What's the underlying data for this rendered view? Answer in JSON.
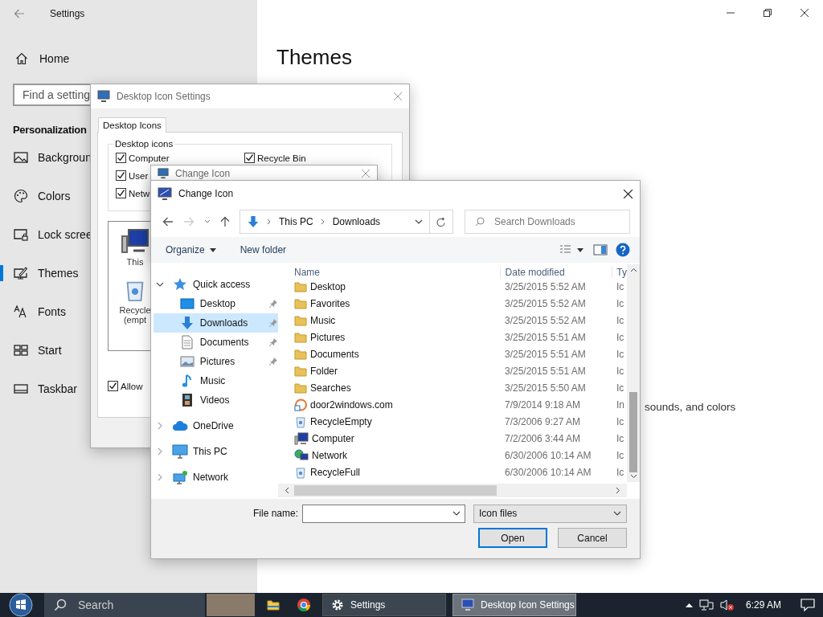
{
  "settings": {
    "title": "Settings",
    "home": "Home",
    "search_placeholder": "Find a setting",
    "section": "Personalization",
    "items": [
      {
        "label": "Backgroun",
        "selected": false
      },
      {
        "label": "Colors",
        "selected": false
      },
      {
        "label": "Lock scree",
        "selected": false
      },
      {
        "label": "Themes",
        "selected": true
      },
      {
        "label": "Fonts",
        "selected": false
      },
      {
        "label": "Start",
        "selected": false
      },
      {
        "label": "Taskbar",
        "selected": false
      }
    ],
    "heading": "Themes",
    "body_text": "sounds, and colors"
  },
  "desktop_icon_settings": {
    "title": "Desktop Icon Settings",
    "tab": "Desktop Icons",
    "group": "Desktop icons",
    "checkboxes": [
      {
        "label": "Computer",
        "checked": true
      },
      {
        "label": "Recycle Bin",
        "checked": true
      },
      {
        "label": "User",
        "checked": true
      },
      {
        "label": "Netw",
        "checked": true
      }
    ],
    "icons": [
      {
        "lines": [
          "This"
        ]
      },
      {
        "lines": [
          "Recycle",
          "(empt"
        ]
      }
    ],
    "allow": {
      "label": "Allow",
      "checked": true
    }
  },
  "change_icon_back": {
    "title": "Change Icon"
  },
  "dialog": {
    "title": "Change Icon",
    "breadcrumb": [
      "This PC",
      "Downloads"
    ],
    "search_placeholder": "Search Downloads",
    "organize": "Organize",
    "new_folder": "New folder",
    "nav_tree": [
      {
        "label": "Quick access",
        "expanded": true,
        "selected": false,
        "children": [
          {
            "label": "Desktop",
            "pinned": true,
            "selected": false
          },
          {
            "label": "Downloads",
            "pinned": true,
            "selected": true
          },
          {
            "label": "Documents",
            "pinned": true,
            "selected": false
          },
          {
            "label": "Pictures",
            "pinned": true,
            "selected": false
          },
          {
            "label": "Music",
            "pinned": false,
            "selected": false
          },
          {
            "label": "Videos",
            "pinned": false,
            "selected": false
          }
        ]
      },
      {
        "label": "OneDrive",
        "expanded": false,
        "selected": false
      },
      {
        "label": "This PC",
        "expanded": false,
        "selected": false
      },
      {
        "label": "Network",
        "expanded": false,
        "selected": false
      }
    ],
    "columns": [
      "Name",
      "Date modified",
      "Ty"
    ],
    "rows": [
      {
        "name": "Desktop",
        "date": "3/25/2015 5:52 AM",
        "type": "Ic",
        "kind": "folder"
      },
      {
        "name": "Favorites",
        "date": "3/25/2015 5:52 AM",
        "type": "Ic",
        "kind": "folder"
      },
      {
        "name": "Music",
        "date": "3/25/2015 5:52 AM",
        "type": "Ic",
        "kind": "folder"
      },
      {
        "name": "Pictures",
        "date": "3/25/2015 5:51 AM",
        "type": "Ic",
        "kind": "folder"
      },
      {
        "name": "Documents",
        "date": "3/25/2015 5:51 AM",
        "type": "Ic",
        "kind": "folder"
      },
      {
        "name": "Folder",
        "date": "3/25/2015 5:51 AM",
        "type": "Ic",
        "kind": "folder"
      },
      {
        "name": "Searches",
        "date": "3/25/2015 5:50 AM",
        "type": "Ic",
        "kind": "folder"
      },
      {
        "name": "door2windows.com",
        "date": "7/9/2014 9:18 AM",
        "type": "In",
        "kind": "link"
      },
      {
        "name": "RecycleEmpty",
        "date": "7/3/2006 9:27 AM",
        "type": "Ic",
        "kind": "bin"
      },
      {
        "name": "Computer",
        "date": "7/2/2006 3:44 AM",
        "type": "Ic",
        "kind": "computer"
      },
      {
        "name": "Network",
        "date": "6/30/2006 10:14 AM",
        "type": "Ic",
        "kind": "network"
      },
      {
        "name": "RecycleFull",
        "date": "6/30/2006 10:14 AM",
        "type": "Ic",
        "kind": "bin"
      }
    ],
    "file_name_label": "File name:",
    "filter": "Icon files",
    "open": "Open",
    "cancel": "Cancel"
  },
  "taskbar": {
    "search_placeholder": "Search",
    "tasks": [
      {
        "label": "Settings",
        "selected": false
      },
      {
        "label": "Desktop Icon Settings",
        "selected": true
      }
    ],
    "clock": "6:29 AM"
  }
}
